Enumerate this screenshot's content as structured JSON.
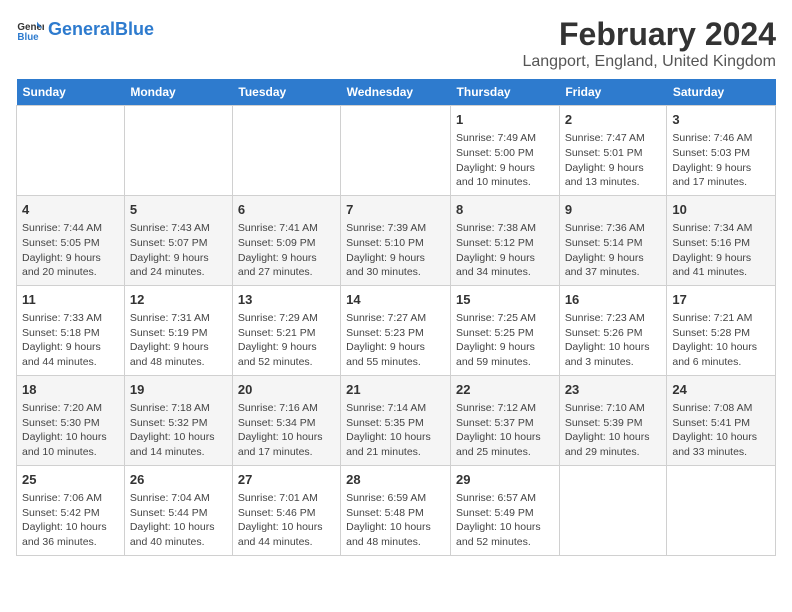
{
  "logo": {
    "text_general": "General",
    "text_blue": "Blue"
  },
  "header": {
    "title": "February 2024",
    "subtitle": "Langport, England, United Kingdom"
  },
  "weekdays": [
    "Sunday",
    "Monday",
    "Tuesday",
    "Wednesday",
    "Thursday",
    "Friday",
    "Saturday"
  ],
  "weeks": [
    [
      {
        "day": "",
        "info": ""
      },
      {
        "day": "",
        "info": ""
      },
      {
        "day": "",
        "info": ""
      },
      {
        "day": "",
        "info": ""
      },
      {
        "day": "1",
        "info": "Sunrise: 7:49 AM\nSunset: 5:00 PM\nDaylight: 9 hours\nand 10 minutes."
      },
      {
        "day": "2",
        "info": "Sunrise: 7:47 AM\nSunset: 5:01 PM\nDaylight: 9 hours\nand 13 minutes."
      },
      {
        "day": "3",
        "info": "Sunrise: 7:46 AM\nSunset: 5:03 PM\nDaylight: 9 hours\nand 17 minutes."
      }
    ],
    [
      {
        "day": "4",
        "info": "Sunrise: 7:44 AM\nSunset: 5:05 PM\nDaylight: 9 hours\nand 20 minutes."
      },
      {
        "day": "5",
        "info": "Sunrise: 7:43 AM\nSunset: 5:07 PM\nDaylight: 9 hours\nand 24 minutes."
      },
      {
        "day": "6",
        "info": "Sunrise: 7:41 AM\nSunset: 5:09 PM\nDaylight: 9 hours\nand 27 minutes."
      },
      {
        "day": "7",
        "info": "Sunrise: 7:39 AM\nSunset: 5:10 PM\nDaylight: 9 hours\nand 30 minutes."
      },
      {
        "day": "8",
        "info": "Sunrise: 7:38 AM\nSunset: 5:12 PM\nDaylight: 9 hours\nand 34 minutes."
      },
      {
        "day": "9",
        "info": "Sunrise: 7:36 AM\nSunset: 5:14 PM\nDaylight: 9 hours\nand 37 minutes."
      },
      {
        "day": "10",
        "info": "Sunrise: 7:34 AM\nSunset: 5:16 PM\nDaylight: 9 hours\nand 41 minutes."
      }
    ],
    [
      {
        "day": "11",
        "info": "Sunrise: 7:33 AM\nSunset: 5:18 PM\nDaylight: 9 hours\nand 44 minutes."
      },
      {
        "day": "12",
        "info": "Sunrise: 7:31 AM\nSunset: 5:19 PM\nDaylight: 9 hours\nand 48 minutes."
      },
      {
        "day": "13",
        "info": "Sunrise: 7:29 AM\nSunset: 5:21 PM\nDaylight: 9 hours\nand 52 minutes."
      },
      {
        "day": "14",
        "info": "Sunrise: 7:27 AM\nSunset: 5:23 PM\nDaylight: 9 hours\nand 55 minutes."
      },
      {
        "day": "15",
        "info": "Sunrise: 7:25 AM\nSunset: 5:25 PM\nDaylight: 9 hours\nand 59 minutes."
      },
      {
        "day": "16",
        "info": "Sunrise: 7:23 AM\nSunset: 5:26 PM\nDaylight: 10 hours\nand 3 minutes."
      },
      {
        "day": "17",
        "info": "Sunrise: 7:21 AM\nSunset: 5:28 PM\nDaylight: 10 hours\nand 6 minutes."
      }
    ],
    [
      {
        "day": "18",
        "info": "Sunrise: 7:20 AM\nSunset: 5:30 PM\nDaylight: 10 hours\nand 10 minutes."
      },
      {
        "day": "19",
        "info": "Sunrise: 7:18 AM\nSunset: 5:32 PM\nDaylight: 10 hours\nand 14 minutes."
      },
      {
        "day": "20",
        "info": "Sunrise: 7:16 AM\nSunset: 5:34 PM\nDaylight: 10 hours\nand 17 minutes."
      },
      {
        "day": "21",
        "info": "Sunrise: 7:14 AM\nSunset: 5:35 PM\nDaylight: 10 hours\nand 21 minutes."
      },
      {
        "day": "22",
        "info": "Sunrise: 7:12 AM\nSunset: 5:37 PM\nDaylight: 10 hours\nand 25 minutes."
      },
      {
        "day": "23",
        "info": "Sunrise: 7:10 AM\nSunset: 5:39 PM\nDaylight: 10 hours\nand 29 minutes."
      },
      {
        "day": "24",
        "info": "Sunrise: 7:08 AM\nSunset: 5:41 PM\nDaylight: 10 hours\nand 33 minutes."
      }
    ],
    [
      {
        "day": "25",
        "info": "Sunrise: 7:06 AM\nSunset: 5:42 PM\nDaylight: 10 hours\nand 36 minutes."
      },
      {
        "day": "26",
        "info": "Sunrise: 7:04 AM\nSunset: 5:44 PM\nDaylight: 10 hours\nand 40 minutes."
      },
      {
        "day": "27",
        "info": "Sunrise: 7:01 AM\nSunset: 5:46 PM\nDaylight: 10 hours\nand 44 minutes."
      },
      {
        "day": "28",
        "info": "Sunrise: 6:59 AM\nSunset: 5:48 PM\nDaylight: 10 hours\nand 48 minutes."
      },
      {
        "day": "29",
        "info": "Sunrise: 6:57 AM\nSunset: 5:49 PM\nDaylight: 10 hours\nand 52 minutes."
      },
      {
        "day": "",
        "info": ""
      },
      {
        "day": "",
        "info": ""
      }
    ]
  ]
}
